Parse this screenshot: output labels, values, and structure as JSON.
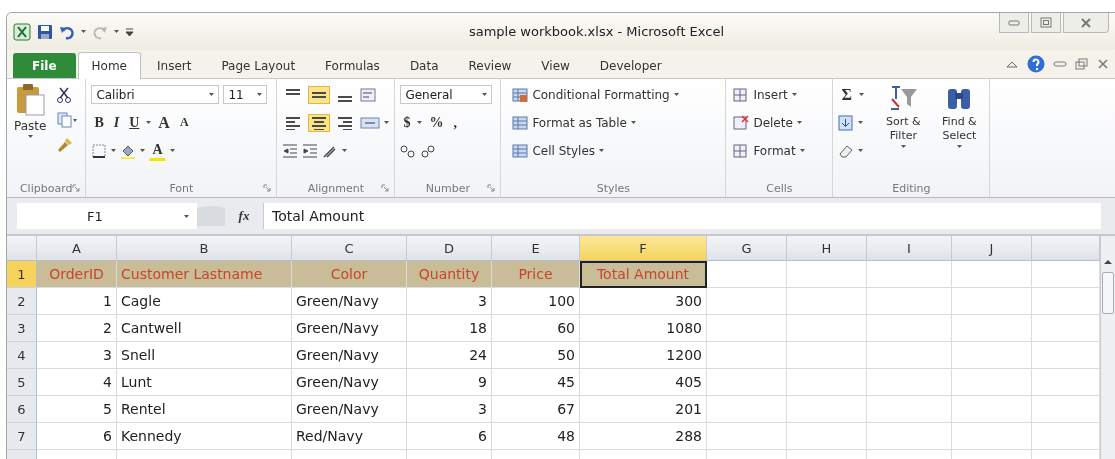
{
  "window": {
    "title": "sample workbook.xlsx - Microsoft Excel"
  },
  "tabs": [
    {
      "label": "File",
      "kind": "file",
      "selected": false
    },
    {
      "label": "Home",
      "kind": "tab",
      "selected": true
    },
    {
      "label": "Insert",
      "kind": "tab",
      "selected": false
    },
    {
      "label": "Page Layout",
      "kind": "tab",
      "selected": false
    },
    {
      "label": "Formulas",
      "kind": "tab",
      "selected": false
    },
    {
      "label": "Data",
      "kind": "tab",
      "selected": false
    },
    {
      "label": "Review",
      "kind": "tab",
      "selected": false
    },
    {
      "label": "View",
      "kind": "tab",
      "selected": false
    },
    {
      "label": "Developer",
      "kind": "tab",
      "selected": false
    }
  ],
  "ribbon": {
    "groups": [
      {
        "kind": "clipboard",
        "label": "Clipboard",
        "paste": "Paste"
      },
      {
        "kind": "font",
        "label": "Font",
        "font_name": "Calibri",
        "font_size": "11",
        "styles": [
          "B",
          "I",
          "U"
        ],
        "grow_shrink": [
          "A",
          "A"
        ],
        "color_letter": "A"
      },
      {
        "kind": "alignment",
        "label": "Alignment",
        "vertical": [
          {
            "selected": false
          },
          {
            "selected": true
          },
          {
            "selected": false
          }
        ],
        "horizontal": [
          {
            "selected": false
          },
          {
            "selected": true
          },
          {
            "selected": false
          }
        ]
      },
      {
        "kind": "number",
        "label": "Number",
        "format": "General",
        "symbols": [
          "$",
          "%",
          ","
        ]
      },
      {
        "kind": "styles",
        "label": "Styles",
        "items": [
          "Conditional Formatting",
          "Format as Table",
          "Cell Styles"
        ]
      },
      {
        "kind": "cells",
        "label": "Cells",
        "items": [
          "Insert",
          "Delete",
          "Format"
        ]
      },
      {
        "kind": "editing",
        "label": "Editing",
        "sigma": "Σ",
        "items": [
          "Sort & Filter",
          "Find & Select"
        ]
      }
    ]
  },
  "formula_bar": {
    "name_box": "F1",
    "function_label": "fx",
    "value": "Total Amount"
  },
  "sheet": {
    "columns": [
      {
        "label": "A",
        "selected": false
      },
      {
        "label": "B",
        "selected": false
      },
      {
        "label": "C",
        "selected": false
      },
      {
        "label": "D",
        "selected": false
      },
      {
        "label": "E",
        "selected": false
      },
      {
        "label": "F",
        "selected": true
      },
      {
        "label": "G",
        "selected": false
      },
      {
        "label": "H",
        "selected": false
      },
      {
        "label": "I",
        "selected": false
      },
      {
        "label": "J",
        "selected": false
      }
    ],
    "rows": [
      {
        "number": "1",
        "kind": "header",
        "selected": true,
        "cells": [
          "OrderID",
          "Customer Lastname",
          "Color",
          "Quantity",
          "Price",
          "Total Amount"
        ]
      },
      {
        "number": "2",
        "kind": "data",
        "selected": false,
        "cells": [
          "1",
          "Cagle",
          "Green/Navy",
          "3",
          "100",
          "300"
        ]
      },
      {
        "number": "3",
        "kind": "data",
        "selected": false,
        "cells": [
          "2",
          "Cantwell",
          "Green/Navy",
          "18",
          "60",
          "1080"
        ]
      },
      {
        "number": "4",
        "kind": "data",
        "selected": false,
        "cells": [
          "3",
          "Snell",
          "Green/Navy",
          "24",
          "50",
          "1200"
        ]
      },
      {
        "number": "5",
        "kind": "data",
        "selected": false,
        "cells": [
          "4",
          "Lunt",
          "Green/Navy",
          "9",
          "45",
          "405"
        ]
      },
      {
        "number": "6",
        "kind": "data",
        "selected": false,
        "cells": [
          "5",
          "Rentel",
          "Green/Navy",
          "3",
          "67",
          "201"
        ]
      },
      {
        "number": "7",
        "kind": "data",
        "selected": false,
        "cells": [
          "6",
          "Kennedy",
          "Red/Navy",
          "6",
          "48",
          "288"
        ]
      }
    ]
  }
}
